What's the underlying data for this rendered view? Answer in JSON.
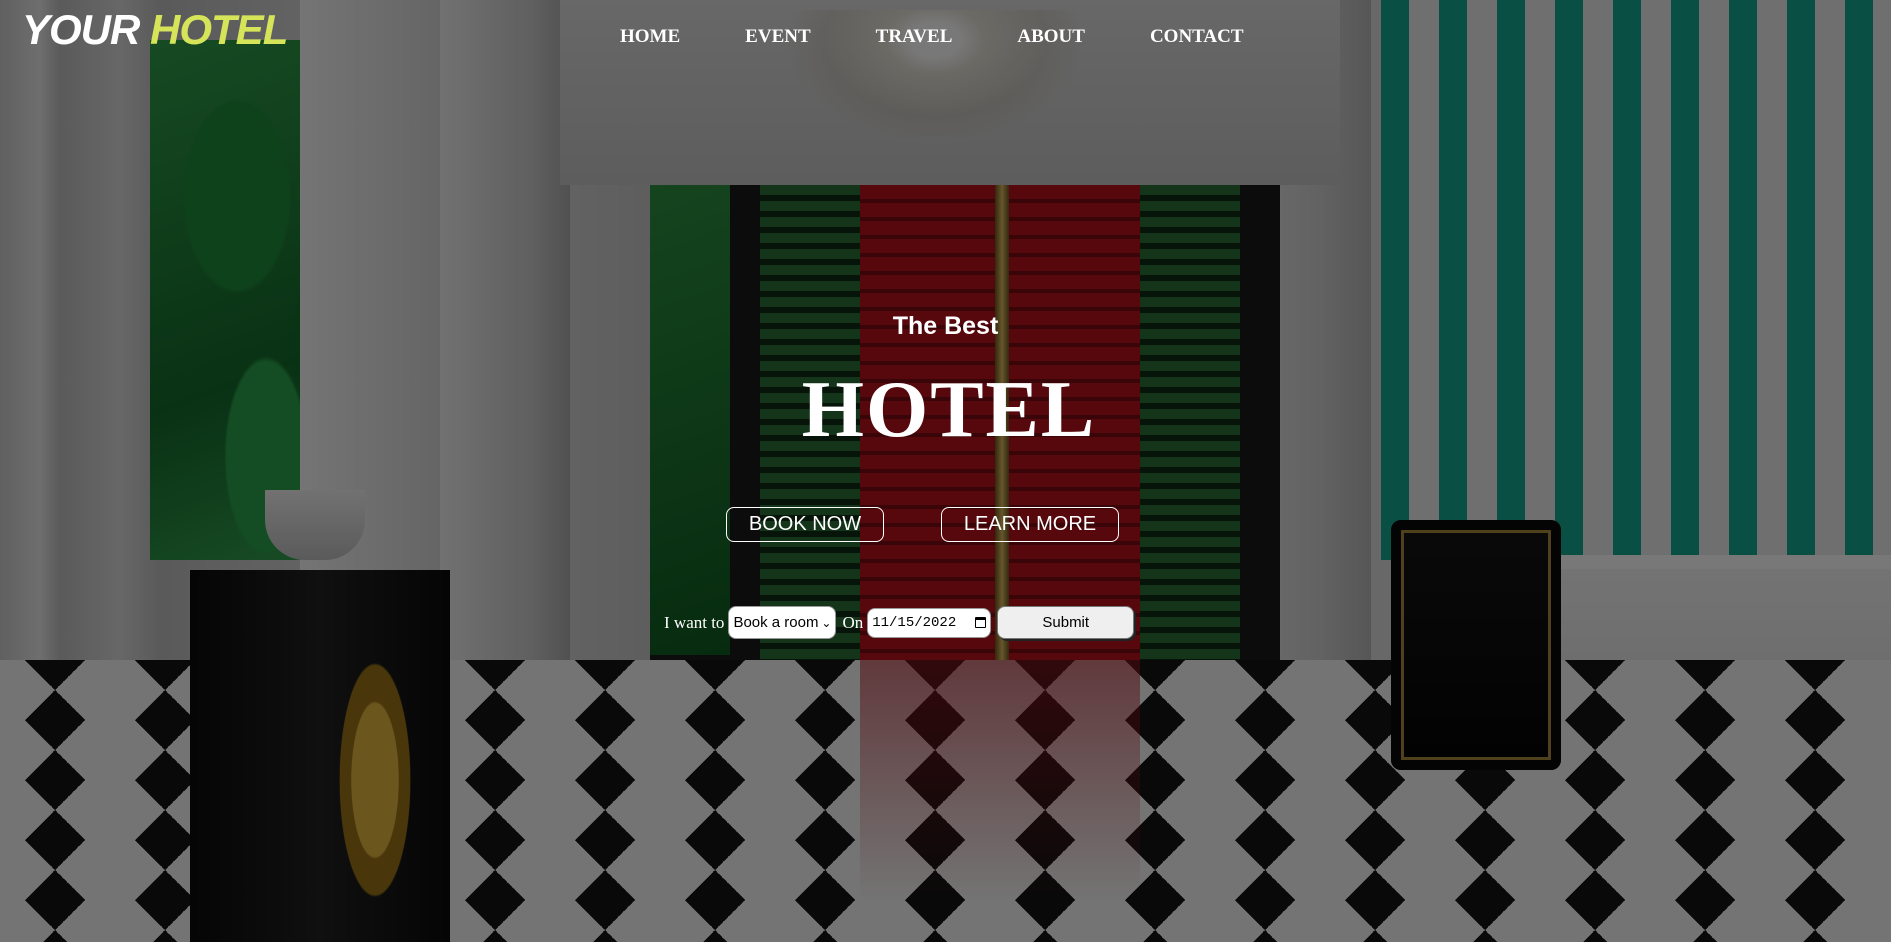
{
  "header": {
    "logo": {
      "word1": "YOUR",
      "word2": "HOTEL"
    },
    "nav": [
      {
        "label": "HOME"
      },
      {
        "label": "EVENT"
      },
      {
        "label": "TRAVEL"
      },
      {
        "label": "ABOUT"
      },
      {
        "label": "CONTACT"
      }
    ]
  },
  "hero": {
    "subtitle": "The Best",
    "title": "HOTEL",
    "book_now": "BOOK NOW",
    "learn_more": "LEARN MORE"
  },
  "form": {
    "i_want_to": "I want to",
    "select_value": "Book a room",
    "on": "On",
    "date_value": "11/15/2022",
    "submit": "Submit"
  },
  "colors": {
    "logo_accent": "#d6e45a",
    "text": "#ffffff",
    "overlay": "rgba(0,0,0,0.52)"
  },
  "icons": {
    "select_arrow": "chevron-down-icon",
    "date_picker": "calendar-icon"
  }
}
